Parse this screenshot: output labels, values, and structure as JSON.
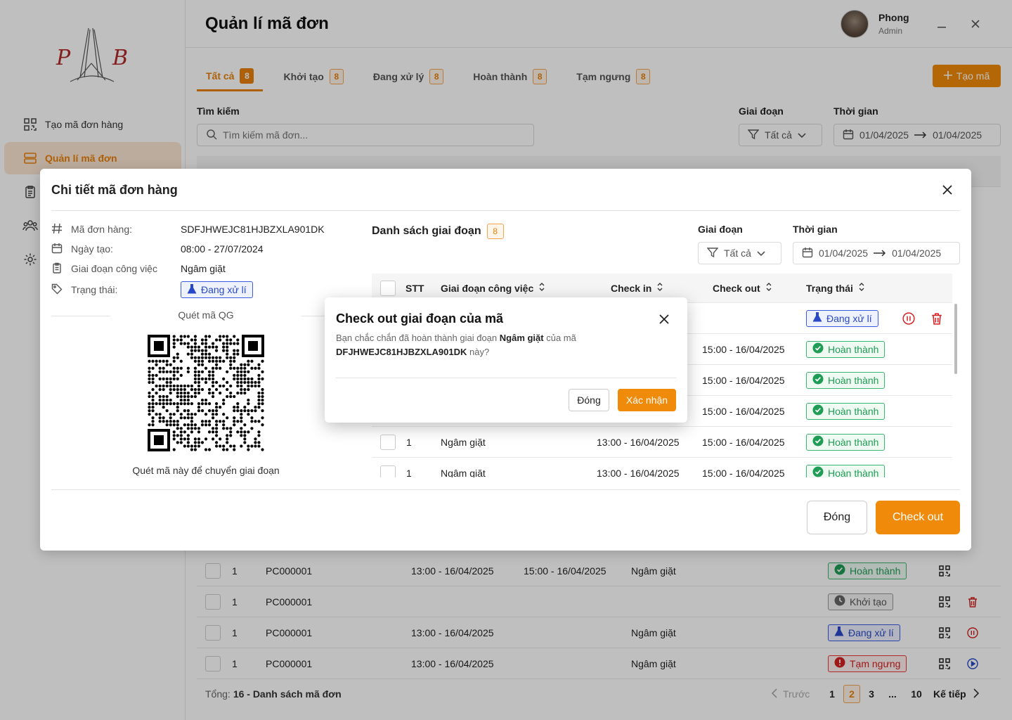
{
  "sidebar": {
    "logo_text": "PHB",
    "items": [
      {
        "label": "Tạo mã đơn hàng",
        "icon": "qr-scan-icon"
      },
      {
        "label": "Quản lí mã đơn",
        "icon": "server-icon"
      },
      {
        "label": "",
        "icon": "clipboard-icon"
      },
      {
        "label": "",
        "icon": "users-icon"
      },
      {
        "label": "",
        "icon": "gear-icon"
      }
    ]
  },
  "header": {
    "title": "Quản lí mã đơn",
    "user_name": "Phong",
    "user_role": "Admin"
  },
  "tabs": [
    {
      "label": "Tất cả",
      "count": "8"
    },
    {
      "label": "Khởi tạo",
      "count": "8"
    },
    {
      "label": "Đang xử lý",
      "count": "8"
    },
    {
      "label": "Hoàn thành",
      "count": "8"
    },
    {
      "label": "Tạm ngưng",
      "count": "8"
    }
  ],
  "create_button": "Tạo mã",
  "filters": {
    "search_label": "Tìm kiếm",
    "search_placeholder": "Tìm kiếm mã đơn...",
    "stage_label": "Giai đoạn",
    "stage_value": "Tất cả",
    "time_label": "Thời gian",
    "date_from": "01/04/2025",
    "date_to": "01/04/2025"
  },
  "bg_rows": [
    {
      "stt": "1",
      "code": "PC000001",
      "checkin": "13:00 - 16/04/2025",
      "checkout": "15:00 - 16/04/2025",
      "stage": "Ngâm giặt",
      "status": "Hoàn thành",
      "kind": "done"
    },
    {
      "stt": "1",
      "code": "PC000001",
      "checkin": "",
      "checkout": "",
      "stage": "",
      "status": "Khởi tạo",
      "kind": "init"
    },
    {
      "stt": "1",
      "code": "PC000001",
      "checkin": "13:00 - 16/04/2025",
      "checkout": "",
      "stage": "Ngâm giặt",
      "status": "Đang xử lí",
      "kind": "proc"
    },
    {
      "stt": "1",
      "code": "PC000001",
      "checkin": "13:00 - 16/04/2025",
      "checkout": "",
      "stage": "Ngâm giặt",
      "status": "Tạm ngưng",
      "kind": "stop"
    }
  ],
  "pagination": {
    "total_prefix": "Tổng:",
    "total_text": "16 - Danh sách mã đơn",
    "prev": "Trước",
    "pages": [
      "1",
      "2",
      "3",
      "...",
      "10"
    ],
    "next": "Kế tiếp"
  },
  "modal": {
    "title": "Chi tiết mã đơn hàng",
    "info": [
      {
        "label": "Mã đơn hàng:",
        "value": "SDFJHWEJC81HJBZXLA901DK"
      },
      {
        "label": "Ngày tạo:",
        "value": "08:00 - 27/07/2024"
      },
      {
        "label": "Giai đoạn công việc",
        "value": "Ngâm giặt"
      },
      {
        "label": "Trạng thái:",
        "value": "Đang xử lí"
      }
    ],
    "qr_title": "Quét mã QG",
    "qr_caption": "Quét mã này để chuyển giai đoạn",
    "list_title": "Danh sách giai đoạn",
    "list_count": "8",
    "stage_label": "Giai đoạn",
    "stage_value": "Tất cả",
    "time_label": "Thời gian",
    "date_from": "01/04/2025",
    "date_to": "01/04/2025",
    "columns": [
      "STT",
      "Giai đoạn công việc",
      "Check in",
      "Check out",
      "Trạng thái"
    ],
    "rows": [
      {
        "stt": "",
        "stage": "",
        "checkin": "",
        "checkout": "",
        "status": "Đang xử lí",
        "kind": "proc"
      },
      {
        "stt": "",
        "stage": "",
        "checkin": "",
        "checkout": "15:00 - 16/04/2025",
        "status": "Hoàn thành",
        "kind": "done"
      },
      {
        "stt": "",
        "stage": "",
        "checkin": "",
        "checkout": "15:00 - 16/04/2025",
        "status": "Hoàn thành",
        "kind": "done"
      },
      {
        "stt": "",
        "stage": "",
        "checkin": "",
        "checkout": "15:00 - 16/04/2025",
        "status": "Hoàn thành",
        "kind": "done"
      },
      {
        "stt": "1",
        "stage": "Ngâm giặt",
        "checkin": "13:00 - 16/04/2025",
        "checkout": "15:00 - 16/04/2025",
        "status": "Hoàn thành",
        "kind": "done"
      },
      {
        "stt": "1",
        "stage": "Ngâm giặt",
        "checkin": "13:00 - 16/04/2025",
        "checkout": "15:00 - 16/04/2025",
        "status": "Hoàn thành",
        "kind": "done"
      }
    ],
    "close_button": "Đóng",
    "checkout_button": "Check out"
  },
  "confirm": {
    "title": "Check out giai đoạn của mã",
    "body_prefix": "Bạn chắc chắn đã hoàn thành giai đoạn",
    "stage": "Ngâm giặt",
    "body_mid": "của mã",
    "code": "DFJHWEJC81HJBZXLA901DK",
    "body_suffix": "này?",
    "close_button": "Đóng",
    "ok_button": "Xác nhận"
  },
  "colors": {
    "accent": "#f08a0a",
    "done": "#1f9d55",
    "processing": "#2948c7",
    "stopped": "#d32020"
  }
}
